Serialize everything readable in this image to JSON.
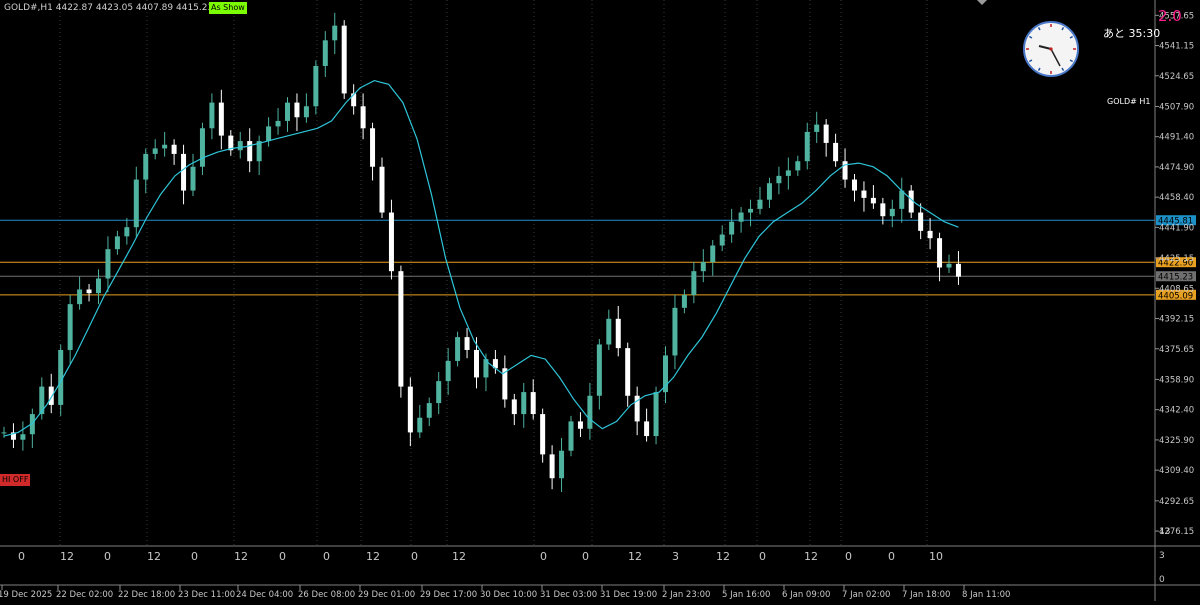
{
  "header": {
    "symbol_info": "GOLD#,H1  4422.87 4423.05 4407.89 4415.23",
    "as_show_button": "As Show",
    "chart_label": "GOLD# H1",
    "spread": "2.0",
    "countdown": "あと 35:30",
    "hi_off_button": "HI OFF"
  },
  "indicator_ticks": [
    "0",
    "12",
    "0",
    "12",
    "0",
    "12",
    "0",
    "0",
    "12",
    "0",
    "12",
    "0",
    "0",
    "12",
    "3",
    "12",
    "0",
    "12",
    "0",
    "0",
    "10"
  ],
  "indicator_right_axis": [
    "13",
    "3",
    "0"
  ],
  "colors": {
    "background": "#000000",
    "bull_candle": "#4fb3a0",
    "bear_candle": "#ffffff",
    "moving_average": "#2ec5d8",
    "blue_line": "#1e90c8",
    "orange_line": "#e8a020",
    "grid": "#3a3a3a"
  },
  "chart_data": {
    "type": "candlestick",
    "symbol": "GOLD#",
    "timeframe": "H1",
    "ohlc_current": {
      "open": 4422.87,
      "high": 4423.05,
      "low": 4407.89,
      "close": 4415.23
    },
    "ylim": [
      4268,
      4566
    ],
    "y_ticks": [
      "4557.65",
      "4541.15",
      "4524.65",
      "4507.90",
      "4491.40",
      "4474.90",
      "4458.40",
      "4441.90",
      "4425.15",
      "4408.65",
      "4392.15",
      "4375.65",
      "4358.90",
      "4342.40",
      "4325.90",
      "4309.40",
      "4292.65",
      "4276.15"
    ],
    "x_ticks": [
      "19 Dec 2025",
      "22 Dec 02:00",
      "22 Dec 18:00",
      "23 Dec 11:00",
      "24 Dec 04:00",
      "26 Dec 08:00",
      "29 Dec 01:00",
      "29 Dec 17:00",
      "30 Dec 10:00",
      "31 Dec 03:00",
      "31 Dec 19:00",
      "2 Jan 23:00",
      "5 Jan 16:00",
      "6 Jan 09:00",
      "7 Jan 02:00",
      "7 Jan 18:00",
      "8 Jan 11:00"
    ],
    "horizontal_lines": [
      {
        "price": 4445.81,
        "label": "4445.81",
        "color": "#1e90c8"
      },
      {
        "price": 4422.9,
        "label": "4422.90",
        "color": "#e8a020"
      },
      {
        "price": 4415.23,
        "label": "4415.23",
        "color": "#707070"
      },
      {
        "price": 4405.09,
        "label": "4405.09",
        "color": "#e8a020"
      }
    ],
    "close_path": [
      4330,
      4326,
      4329,
      4340,
      4355,
      4345,
      4375,
      4400,
      4408,
      4406,
      4414,
      4430,
      4437,
      4442,
      4468,
      4482,
      4485,
      4487,
      4482,
      4462,
      4475,
      4496,
      4510,
      4492,
      4484,
      4489,
      4478,
      4489,
      4497,
      4500,
      4510,
      4502,
      4508,
      4530,
      4544,
      4552,
      4515,
      4508,
      4496,
      4475,
      4450,
      4418,
      4355,
      4330,
      4338,
      4346,
      4358,
      4369,
      4382,
      4375,
      4360,
      4370,
      4365,
      4348,
      4340,
      4352,
      4340,
      4318,
      4305,
      4320,
      4336,
      4332,
      4350,
      4378,
      4392,
      4376,
      4350,
      4336,
      4328,
      4352,
      4372,
      4398,
      4405,
      4418,
      4423,
      4432,
      4438,
      4445,
      4450,
      4452,
      4457,
      4466,
      4470,
      4473,
      4478,
      4494,
      4498,
      4488,
      4478,
      4468,
      4462,
      4458,
      4455,
      4448,
      4452,
      4462,
      4450,
      4440,
      4436,
      4420,
      4422,
      4415
    ],
    "moving_average_path": [
      4328,
      4330,
      4335,
      4345,
      4358,
      4372,
      4388,
      4404,
      4418,
      4432,
      4447,
      4460,
      4470,
      4476,
      4480,
      4483,
      4485,
      4486,
      4488,
      4490,
      4492,
      4494,
      4496,
      4500,
      4510,
      4518,
      4522,
      4520,
      4510,
      4490,
      4460,
      4425,
      4398,
      4380,
      4368,
      4362,
      4367,
      4372,
      4370,
      4360,
      4348,
      4338,
      4332,
      4336,
      4345,
      4350,
      4352,
      4360,
      4372,
      4382,
      4395,
      4410,
      4425,
      4437,
      4445,
      4450,
      4455,
      4462,
      4470,
      4476,
      4477,
      4475,
      4470,
      4462,
      4455,
      4450,
      4445,
      4442
    ]
  }
}
